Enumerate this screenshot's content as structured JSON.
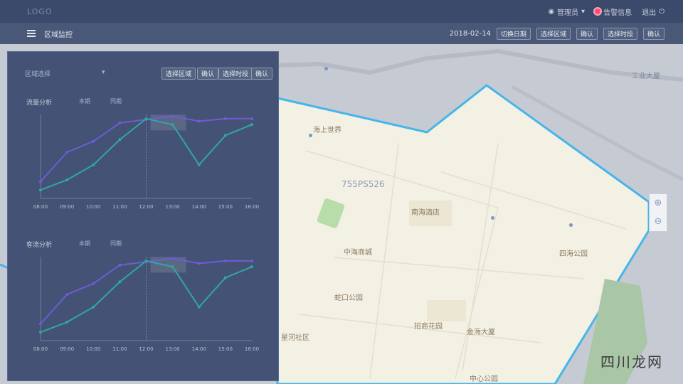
{
  "app": {
    "logo": "LOGO"
  },
  "topbar": {
    "user_menu": "管理员",
    "alert": "告警信息",
    "exit": "退出"
  },
  "secbar": {
    "title": "区域监控",
    "date": "2018-02-14",
    "date_btn": "切换日期",
    "select1": "选择区域",
    "select1_btn": "确认",
    "select2": "选择时段",
    "select2_btn": "确认"
  },
  "panel": {
    "dropdown": "区域选择",
    "btn1": "选择区域",
    "btn1_tag": "确认",
    "btn2": "选择时段",
    "btn2_tag": "确认"
  },
  "chart1": {
    "title": "流量分析",
    "legend": [
      "本期",
      "同期"
    ]
  },
  "chart2": {
    "title": "客流分析",
    "legend": [
      "本期",
      "同期"
    ]
  },
  "map": {
    "region_code": "755PS526",
    "labels": [
      "海上世界",
      "蛇口公园",
      "中海商城",
      "南海酒店",
      "四海公园",
      "招商花园",
      "金海大厦",
      "星河社区",
      "工业大厦",
      "中心公园"
    ]
  },
  "watermark": "四川龙网",
  "colors": {
    "panel": "#3f4f72",
    "purple": "#6b57d6",
    "teal": "#2aa6a0",
    "border": "#45b5ea"
  },
  "chart_data": [
    {
      "type": "line",
      "x": [
        "08:00",
        "09:00",
        "10:00",
        "11:00",
        "12:00",
        "13:00",
        "14:00",
        "15:00",
        "16:00"
      ],
      "series": [
        {
          "name": "本期",
          "values": [
            20,
            55,
            68,
            90,
            94,
            98,
            92,
            95,
            95
          ]
        },
        {
          "name": "同期",
          "values": [
            10,
            22,
            40,
            70,
            95,
            88,
            40,
            75,
            88
          ]
        }
      ]
    },
    {
      "type": "line",
      "x": [
        "08:00",
        "09:00",
        "10:00",
        "11:00",
        "12:00",
        "13:00",
        "14:00",
        "15:00",
        "16:00"
      ],
      "series": [
        {
          "name": "本期",
          "values": [
            20,
            55,
            68,
            90,
            94,
            98,
            92,
            95,
            95
          ]
        },
        {
          "name": "同期",
          "values": [
            10,
            22,
            40,
            70,
            95,
            88,
            40,
            75,
            88
          ]
        }
      ]
    }
  ]
}
